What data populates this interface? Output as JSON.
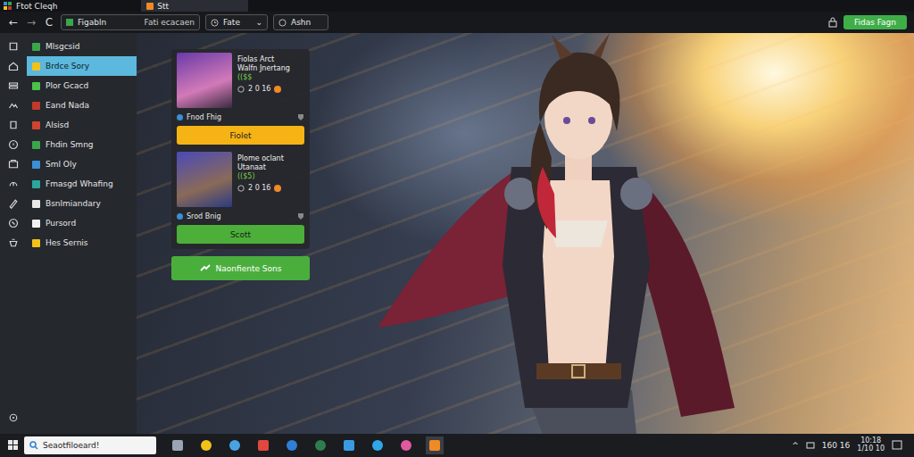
{
  "window": {
    "title": "Ftot Cleqh",
    "tab": "Stt"
  },
  "toolbar": {
    "back": "←",
    "forward": "→",
    "refresh": "C",
    "address": "Figabln",
    "address_hint": "Fati ecacaen",
    "dropdown": "Fate",
    "dropdown_arrow": "⌄",
    "search": "Ashn",
    "action_button": "Fidas Fagn"
  },
  "sidebar": {
    "items": [
      {
        "label": "Mlsgcsid",
        "color": "#3aa64a",
        "selected": false
      },
      {
        "label": "Brdce Sory",
        "color": "#f2c21b",
        "selected": true
      },
      {
        "label": "Plor Gcacd",
        "color": "#4cc24a",
        "selected": false
      },
      {
        "label": "Eand Nada",
        "color": "#c0392b",
        "selected": false
      },
      {
        "label": "Alsisd",
        "color": "#d0432f",
        "selected": false
      },
      {
        "label": "Fhdin Smng",
        "color": "#3aa64a",
        "selected": false
      },
      {
        "label": "Sml Oly",
        "color": "#3a8fd6",
        "selected": false
      },
      {
        "label": "Fmasgd Whafing",
        "color": "#2aa7a0",
        "selected": false
      },
      {
        "label": "Bsnlmiandary",
        "color": "#e8e8e8",
        "selected": false
      },
      {
        "label": "Pursord",
        "color": "#f0f0f0",
        "selected": false
      },
      {
        "label": "Hes Sernis",
        "color": "#f2c21b",
        "selected": false
      }
    ]
  },
  "cards": [
    {
      "title": "Fiolas Arct",
      "subtitle": "Walfn Jnertang",
      "tag": "(($$",
      "stats": "2 0 16",
      "owner": "Fnod Fhig",
      "button": {
        "label": "Fiolet",
        "color": "#f5b316"
      }
    },
    {
      "title": "Plome oclant",
      "subtitle": "Utanaat",
      "tag": "(($5)",
      "stats": "2 0 16",
      "owner": "Srod Bnig",
      "button": {
        "label": "Scott",
        "color": "#4caf3a"
      }
    }
  ],
  "main_button": "Naonfiente Sons",
  "taskbar": {
    "search": "Seaotfiloeard!",
    "tray_arrow": "^",
    "tray_text": "160 16",
    "clock": [
      "10:18",
      "1/10 10"
    ]
  }
}
